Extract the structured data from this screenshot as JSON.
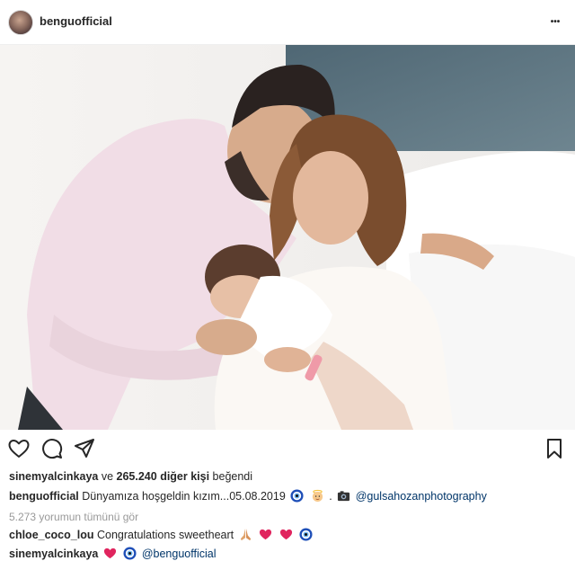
{
  "post": {
    "username": "benguofficial",
    "avatar_icon": "profile-avatar",
    "more_icon": "more-horizontal-icon",
    "more_label": "•••"
  },
  "actions": {
    "like_icon": "heart-outline-icon",
    "comment_icon": "comment-bubble-icon",
    "share_icon": "send-arrow-icon",
    "save_icon": "bookmark-icon"
  },
  "likes": {
    "user": "sinemyalcinkaya",
    "joiner": " ve ",
    "count_text": "265.240 diğer kişi",
    "suffix": " beğendi"
  },
  "caption": {
    "user": "benguofficial",
    "text": "Dünyamıza hoşgeldin kızım...05.08.2019",
    "separator": ".",
    "mention": "@gulsahozanphotography",
    "emojis": [
      "nazar-icon",
      "baby-angel-icon",
      "camera-icon"
    ]
  },
  "view_all_comments": "5.273 yorumun tümünü gör",
  "comments": [
    {
      "user": "chloe_coco_lou",
      "text": "Congratulations sweetheart",
      "emojis": [
        "praying-hands-icon",
        "red-heart-icon",
        "red-heart-icon",
        "nazar-icon"
      ]
    },
    {
      "user": "sinemyalcinkaya",
      "text": "",
      "mention": "@benguofficial",
      "emojis": [
        "red-heart-icon",
        "nazar-icon"
      ]
    }
  ],
  "colors": {
    "text": "#262626",
    "muted": "#999999",
    "link": "#003569",
    "divider": "#efefef",
    "heart": "#e0245e",
    "nazar": "#1e4fb8"
  }
}
